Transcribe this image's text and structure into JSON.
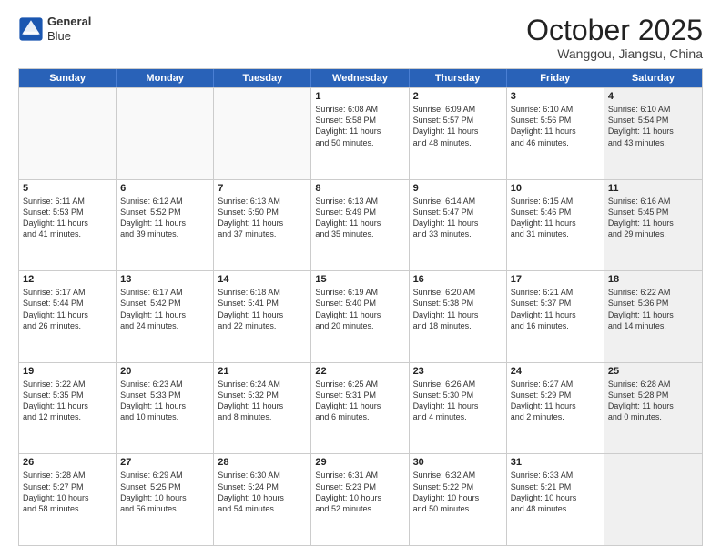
{
  "header": {
    "logo_general": "General",
    "logo_blue": "Blue",
    "month": "October 2025",
    "location": "Wanggou, Jiangsu, China"
  },
  "weekdays": [
    "Sunday",
    "Monday",
    "Tuesday",
    "Wednesday",
    "Thursday",
    "Friday",
    "Saturday"
  ],
  "rows": [
    [
      {
        "num": "",
        "text": "",
        "empty": true
      },
      {
        "num": "",
        "text": "",
        "empty": true
      },
      {
        "num": "",
        "text": "",
        "empty": true
      },
      {
        "num": "1",
        "text": "Sunrise: 6:08 AM\nSunset: 5:58 PM\nDaylight: 11 hours\nand 50 minutes."
      },
      {
        "num": "2",
        "text": "Sunrise: 6:09 AM\nSunset: 5:57 PM\nDaylight: 11 hours\nand 48 minutes."
      },
      {
        "num": "3",
        "text": "Sunrise: 6:10 AM\nSunset: 5:56 PM\nDaylight: 11 hours\nand 46 minutes."
      },
      {
        "num": "4",
        "text": "Sunrise: 6:10 AM\nSunset: 5:54 PM\nDaylight: 11 hours\nand 43 minutes.",
        "shaded": true
      }
    ],
    [
      {
        "num": "5",
        "text": "Sunrise: 6:11 AM\nSunset: 5:53 PM\nDaylight: 11 hours\nand 41 minutes."
      },
      {
        "num": "6",
        "text": "Sunrise: 6:12 AM\nSunset: 5:52 PM\nDaylight: 11 hours\nand 39 minutes."
      },
      {
        "num": "7",
        "text": "Sunrise: 6:13 AM\nSunset: 5:50 PM\nDaylight: 11 hours\nand 37 minutes."
      },
      {
        "num": "8",
        "text": "Sunrise: 6:13 AM\nSunset: 5:49 PM\nDaylight: 11 hours\nand 35 minutes."
      },
      {
        "num": "9",
        "text": "Sunrise: 6:14 AM\nSunset: 5:47 PM\nDaylight: 11 hours\nand 33 minutes."
      },
      {
        "num": "10",
        "text": "Sunrise: 6:15 AM\nSunset: 5:46 PM\nDaylight: 11 hours\nand 31 minutes."
      },
      {
        "num": "11",
        "text": "Sunrise: 6:16 AM\nSunset: 5:45 PM\nDaylight: 11 hours\nand 29 minutes.",
        "shaded": true
      }
    ],
    [
      {
        "num": "12",
        "text": "Sunrise: 6:17 AM\nSunset: 5:44 PM\nDaylight: 11 hours\nand 26 minutes."
      },
      {
        "num": "13",
        "text": "Sunrise: 6:17 AM\nSunset: 5:42 PM\nDaylight: 11 hours\nand 24 minutes."
      },
      {
        "num": "14",
        "text": "Sunrise: 6:18 AM\nSunset: 5:41 PM\nDaylight: 11 hours\nand 22 minutes."
      },
      {
        "num": "15",
        "text": "Sunrise: 6:19 AM\nSunset: 5:40 PM\nDaylight: 11 hours\nand 20 minutes."
      },
      {
        "num": "16",
        "text": "Sunrise: 6:20 AM\nSunset: 5:38 PM\nDaylight: 11 hours\nand 18 minutes."
      },
      {
        "num": "17",
        "text": "Sunrise: 6:21 AM\nSunset: 5:37 PM\nDaylight: 11 hours\nand 16 minutes."
      },
      {
        "num": "18",
        "text": "Sunrise: 6:22 AM\nSunset: 5:36 PM\nDaylight: 11 hours\nand 14 minutes.",
        "shaded": true
      }
    ],
    [
      {
        "num": "19",
        "text": "Sunrise: 6:22 AM\nSunset: 5:35 PM\nDaylight: 11 hours\nand 12 minutes."
      },
      {
        "num": "20",
        "text": "Sunrise: 6:23 AM\nSunset: 5:33 PM\nDaylight: 11 hours\nand 10 minutes."
      },
      {
        "num": "21",
        "text": "Sunrise: 6:24 AM\nSunset: 5:32 PM\nDaylight: 11 hours\nand 8 minutes."
      },
      {
        "num": "22",
        "text": "Sunrise: 6:25 AM\nSunset: 5:31 PM\nDaylight: 11 hours\nand 6 minutes."
      },
      {
        "num": "23",
        "text": "Sunrise: 6:26 AM\nSunset: 5:30 PM\nDaylight: 11 hours\nand 4 minutes."
      },
      {
        "num": "24",
        "text": "Sunrise: 6:27 AM\nSunset: 5:29 PM\nDaylight: 11 hours\nand 2 minutes."
      },
      {
        "num": "25",
        "text": "Sunrise: 6:28 AM\nSunset: 5:28 PM\nDaylight: 11 hours\nand 0 minutes.",
        "shaded": true
      }
    ],
    [
      {
        "num": "26",
        "text": "Sunrise: 6:28 AM\nSunset: 5:27 PM\nDaylight: 10 hours\nand 58 minutes."
      },
      {
        "num": "27",
        "text": "Sunrise: 6:29 AM\nSunset: 5:25 PM\nDaylight: 10 hours\nand 56 minutes."
      },
      {
        "num": "28",
        "text": "Sunrise: 6:30 AM\nSunset: 5:24 PM\nDaylight: 10 hours\nand 54 minutes."
      },
      {
        "num": "29",
        "text": "Sunrise: 6:31 AM\nSunset: 5:23 PM\nDaylight: 10 hours\nand 52 minutes."
      },
      {
        "num": "30",
        "text": "Sunrise: 6:32 AM\nSunset: 5:22 PM\nDaylight: 10 hours\nand 50 minutes."
      },
      {
        "num": "31",
        "text": "Sunrise: 6:33 AM\nSunset: 5:21 PM\nDaylight: 10 hours\nand 48 minutes."
      },
      {
        "num": "",
        "text": "",
        "empty": true,
        "shaded": true
      }
    ]
  ]
}
